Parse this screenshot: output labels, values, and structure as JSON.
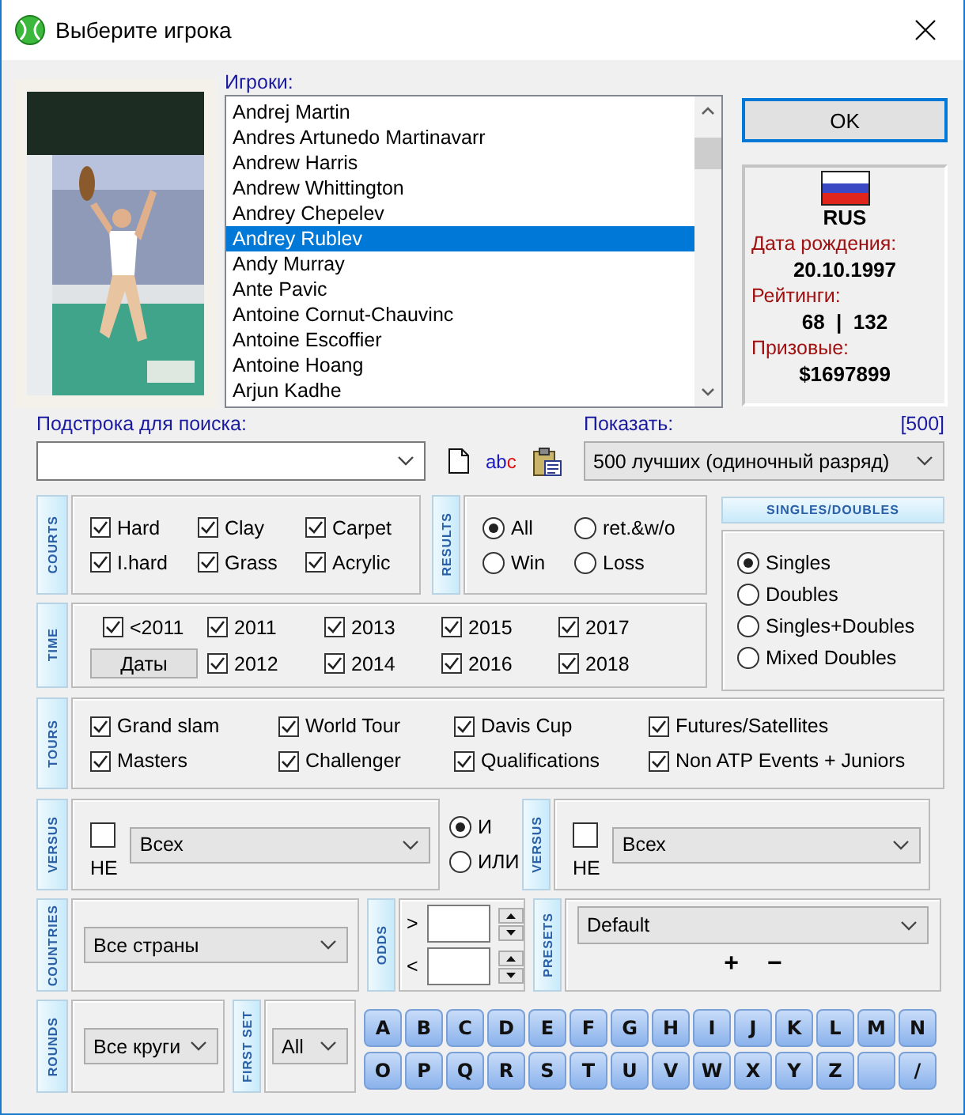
{
  "window": {
    "title": "Выберите игрока"
  },
  "players": {
    "label": "Игроки:",
    "items": [
      {
        "name": "Andrej Martin",
        "selected": false
      },
      {
        "name": "Andres Artunedo Martinavarr",
        "selected": false
      },
      {
        "name": "Andrew Harris",
        "selected": false
      },
      {
        "name": "Andrew Whittington",
        "selected": false
      },
      {
        "name": "Andrey Chepelev",
        "selected": false
      },
      {
        "name": "Andrey Rublev",
        "selected": true
      },
      {
        "name": "Andy Murray",
        "selected": false
      },
      {
        "name": "Ante Pavic",
        "selected": false
      },
      {
        "name": "Antoine Cornut-Chauvinc",
        "selected": false
      },
      {
        "name": "Antoine Escoffier",
        "selected": false
      },
      {
        "name": "Antoine Hoang",
        "selected": false
      },
      {
        "name": "Arjun Kadhe",
        "selected": false
      }
    ]
  },
  "ok_button": "OK",
  "player_info": {
    "country": "RUS",
    "birth_label": "Дата рождения:",
    "birth_date": "20.10.1997",
    "ratings_label": "Рейтинги:",
    "ratings": "68  |  132",
    "prize_label": "Призовые:",
    "prize": "$1697899"
  },
  "search": {
    "label": "Подстрока для поиска:",
    "spell_button": "abc"
  },
  "show": {
    "label": "Показать:",
    "count": "[500]",
    "value": "500 лучших (одиночный разряд)"
  },
  "courts": {
    "title": "COURTS",
    "options": [
      {
        "label": "Hard",
        "checked": true
      },
      {
        "label": "Clay",
        "checked": true
      },
      {
        "label": "Carpet",
        "checked": true
      },
      {
        "label": "I.hard",
        "checked": true
      },
      {
        "label": "Grass",
        "checked": true
      },
      {
        "label": "Acrylic",
        "checked": true
      }
    ]
  },
  "results": {
    "title": "RESULTS",
    "options": [
      {
        "label": "All",
        "selected": true
      },
      {
        "label": "ret.&w/o",
        "selected": false
      },
      {
        "label": "Win",
        "selected": false
      },
      {
        "label": "Loss",
        "selected": false
      }
    ]
  },
  "singles_doubles": {
    "title": "SINGLES/DOUBLES",
    "options": [
      {
        "label": "Singles",
        "selected": true
      },
      {
        "label": "Doubles",
        "selected": false
      },
      {
        "label": "Singles+Doubles",
        "selected": false
      },
      {
        "label": "Mixed Doubles",
        "selected": false
      }
    ]
  },
  "time": {
    "title": "TIME",
    "items": [
      {
        "kind": "checkbox",
        "label": "<2011",
        "checked": true
      },
      {
        "kind": "button",
        "label": "Даты"
      },
      {
        "kind": "checkbox",
        "label": "2011",
        "checked": true
      },
      {
        "kind": "checkbox",
        "label": "2012",
        "checked": true
      },
      {
        "kind": "checkbox",
        "label": "2013",
        "checked": true
      },
      {
        "kind": "checkbox",
        "label": "2014",
        "checked": true
      },
      {
        "kind": "checkbox",
        "label": "2015",
        "checked": true
      },
      {
        "kind": "checkbox",
        "label": "2016",
        "checked": true
      },
      {
        "kind": "checkbox",
        "label": "2017",
        "checked": true
      },
      {
        "kind": "checkbox",
        "label": "2018",
        "checked": true
      }
    ]
  },
  "tours": {
    "title": "TOURS",
    "options": [
      {
        "label": "Grand slam",
        "checked": true
      },
      {
        "label": "World Tour",
        "checked": true
      },
      {
        "label": "Davis Cup",
        "checked": true
      },
      {
        "label": "Futures/Satellites",
        "checked": true
      },
      {
        "label": "Masters",
        "checked": true
      },
      {
        "label": "Challenger",
        "checked": true
      },
      {
        "label": "Qualifications",
        "checked": true
      },
      {
        "label": "Non ATP Events + Juniors",
        "checked": true
      }
    ]
  },
  "versus": [
    {
      "title": "VERSUS",
      "not_label": "НЕ",
      "not_checked": false,
      "value": "Всех"
    },
    {
      "title": "VERSUS",
      "not_label": "НЕ",
      "not_checked": false,
      "value": "Всех"
    }
  ],
  "logic": [
    {
      "label": "И",
      "selected": true
    },
    {
      "label": "ИЛИ",
      "selected": false
    }
  ],
  "countries": {
    "title": "COUNTRIES",
    "value": "Все страны"
  },
  "odds": {
    "title": "ODDS",
    "fields": [
      {
        "sign": ">"
      },
      {
        "sign": "<"
      }
    ]
  },
  "presets": {
    "title": "PRESETS",
    "value": "Default",
    "add": "+",
    "remove": "−"
  },
  "rounds": {
    "title": "ROUNDS",
    "value": "Все круги"
  },
  "first_set": {
    "title": "FIRST SET",
    "value": "All"
  },
  "letters": [
    {
      "kind": "letter",
      "label": "A"
    },
    {
      "kind": "letter",
      "label": "B"
    },
    {
      "kind": "letter",
      "label": "C"
    },
    {
      "kind": "letter",
      "label": "D"
    },
    {
      "kind": "letter",
      "label": "E"
    },
    {
      "kind": "letter",
      "label": "F"
    },
    {
      "kind": "letter",
      "label": "G"
    },
    {
      "kind": "letter",
      "label": "H"
    },
    {
      "kind": "letter",
      "label": "I"
    },
    {
      "kind": "letter",
      "label": "J"
    },
    {
      "kind": "letter",
      "label": "K"
    },
    {
      "kind": "letter",
      "label": "L"
    },
    {
      "kind": "letter",
      "label": "M"
    },
    {
      "kind": "letter",
      "label": "N"
    },
    {
      "kind": "letter",
      "label": "O"
    },
    {
      "kind": "letter",
      "label": "P"
    },
    {
      "kind": "letter",
      "label": "Q"
    },
    {
      "kind": "letter",
      "label": "R"
    },
    {
      "kind": "letter",
      "label": "S"
    },
    {
      "kind": "letter",
      "label": "T"
    },
    {
      "kind": "letter",
      "label": "U"
    },
    {
      "kind": "letter",
      "label": "V"
    },
    {
      "kind": "letter",
      "label": "W"
    },
    {
      "kind": "letter",
      "label": "X"
    },
    {
      "kind": "letter",
      "label": "Y"
    },
    {
      "kind": "letter",
      "label": "Z"
    },
    {
      "kind": "blank"
    },
    {
      "kind": "letter",
      "label": "/"
    }
  ]
}
